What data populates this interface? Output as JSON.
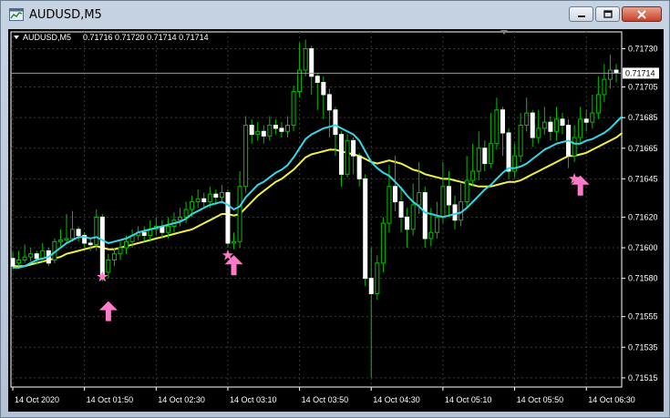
{
  "window": {
    "title": "AUDUSD,M5",
    "icons": [
      "chart-app-icon",
      "minimize-icon",
      "maximize-icon",
      "close-icon"
    ]
  },
  "colors": {
    "background": "#000000",
    "grid": "#3a3a3a",
    "axis_text": "#ffffff",
    "candle_up": "#00c000",
    "candle_body": "#ffffff",
    "ma_fast": "#33d7e8",
    "ma_slow": "#f0f040",
    "signal": "#ff7ac8"
  },
  "chart_data": {
    "type": "candlestick",
    "symbol_label": "AUDUSD,M5",
    "ohlc_label": "0.71716 0.71720 0.71714 0.71714",
    "y_ticks": [
      "0.71730",
      "0.71705",
      "0.71685",
      "0.71665",
      "0.71645",
      "0.71620",
      "0.71600",
      "0.71580",
      "0.71555",
      "0.71535",
      "0.71515"
    ],
    "x_ticks": [
      "14 Oct 2020",
      "14 Oct 01:50",
      "14 Oct 02:30",
      "14 Oct 03:10",
      "14 Oct 03:50",
      "14 Oct 04:30",
      "14 Oct 05:10",
      "14 Oct 05:50",
      "14 Oct 06:30"
    ],
    "current_price": "0.71714",
    "ylim": [
      0.71509,
      0.71741
    ],
    "candles": [
      [
        0.71593,
        0.71588,
        0.71597,
        0.71586
      ],
      [
        0.7159,
        0.71592,
        0.71598,
        0.71588
      ],
      [
        0.71592,
        0.71594,
        0.71602,
        0.7159
      ],
      [
        0.71594,
        0.71596,
        0.716,
        0.71591
      ],
      [
        0.71596,
        0.71593,
        0.71598,
        0.71589
      ],
      [
        0.71593,
        0.71598,
        0.71603,
        0.71591
      ],
      [
        0.71598,
        0.7159,
        0.716,
        0.71588
      ],
      [
        0.71592,
        0.71604,
        0.71606,
        0.7159
      ],
      [
        0.71604,
        0.71605,
        0.71612,
        0.716
      ],
      [
        0.71605,
        0.71606,
        0.71622,
        0.71603
      ],
      [
        0.71606,
        0.71612,
        0.71624,
        0.71604
      ],
      [
        0.71612,
        0.71608,
        0.71614,
        0.71604
      ],
      [
        0.71608,
        0.71603,
        0.7161,
        0.716
      ],
      [
        0.71603,
        0.71602,
        0.71606,
        0.71598
      ],
      [
        0.71602,
        0.7162,
        0.71625,
        0.71598
      ],
      [
        0.7162,
        0.71582,
        0.71622,
        0.71578
      ],
      [
        0.71584,
        0.71592,
        0.71596,
        0.7158
      ],
      [
        0.71592,
        0.71596,
        0.716,
        0.71588
      ],
      [
        0.71596,
        0.716,
        0.71604,
        0.71592
      ],
      [
        0.716,
        0.71604,
        0.71608,
        0.71596
      ],
      [
        0.71604,
        0.71608,
        0.71612,
        0.716
      ],
      [
        0.71608,
        0.7161,
        0.71614,
        0.71605
      ],
      [
        0.7161,
        0.71608,
        0.71614,
        0.71604
      ],
      [
        0.71608,
        0.71612,
        0.71618,
        0.71604
      ],
      [
        0.71612,
        0.71614,
        0.7162,
        0.71608
      ],
      [
        0.71614,
        0.7161,
        0.71618,
        0.71606
      ],
      [
        0.7161,
        0.71614,
        0.7162,
        0.71606
      ],
      [
        0.71614,
        0.71618,
        0.71623,
        0.7161
      ],
      [
        0.71618,
        0.7162,
        0.71626,
        0.71614
      ],
      [
        0.7162,
        0.71625,
        0.7163,
        0.71616
      ],
      [
        0.71625,
        0.7163,
        0.71634,
        0.7162
      ],
      [
        0.7163,
        0.71632,
        0.71638,
        0.71626
      ],
      [
        0.71632,
        0.7163,
        0.71636,
        0.71626
      ],
      [
        0.7163,
        0.71635,
        0.7164,
        0.71626
      ],
      [
        0.71635,
        0.71633,
        0.71638,
        0.71628
      ],
      [
        0.71633,
        0.71636,
        0.71641,
        0.71629
      ],
      [
        0.71636,
        0.71603,
        0.71638,
        0.716
      ],
      [
        0.71603,
        0.71604,
        0.7161,
        0.71599
      ],
      [
        0.71604,
        0.7164,
        0.7165,
        0.716
      ],
      [
        0.7164,
        0.7168,
        0.71686,
        0.71636
      ],
      [
        0.7168,
        0.71674,
        0.71684,
        0.71668
      ],
      [
        0.71674,
        0.71676,
        0.71682,
        0.7167
      ],
      [
        0.71676,
        0.71673,
        0.7168,
        0.71668
      ],
      [
        0.71673,
        0.7168,
        0.71686,
        0.7167
      ],
      [
        0.7168,
        0.71678,
        0.71684,
        0.71674
      ],
      [
        0.71678,
        0.71676,
        0.71682,
        0.71672
      ],
      [
        0.71676,
        0.7168,
        0.71686,
        0.71672
      ],
      [
        0.7168,
        0.71702,
        0.71706,
        0.71676
      ],
      [
        0.71702,
        0.71716,
        0.71734,
        0.71698
      ],
      [
        0.71716,
        0.7173,
        0.71736,
        0.71712
      ],
      [
        0.7173,
        0.71712,
        0.71732,
        0.717
      ],
      [
        0.71712,
        0.71708,
        0.71714,
        0.7169
      ],
      [
        0.71708,
        0.717,
        0.71712,
        0.71684
      ],
      [
        0.717,
        0.7169,
        0.71704,
        0.71672
      ],
      [
        0.7169,
        0.71674,
        0.71692,
        0.7166
      ],
      [
        0.71674,
        0.71648,
        0.71676,
        0.7164
      ],
      [
        0.71648,
        0.7167,
        0.71674,
        0.71646
      ],
      [
        0.7167,
        0.7166,
        0.71672,
        0.71648
      ],
      [
        0.7166,
        0.71645,
        0.71662,
        0.7164
      ],
      [
        0.71645,
        0.7158,
        0.71648,
        0.71575
      ],
      [
        0.7158,
        0.7157,
        0.716,
        0.71515
      ],
      [
        0.7157,
        0.7159,
        0.71595,
        0.71566
      ],
      [
        0.7159,
        0.71616,
        0.7162,
        0.71584
      ],
      [
        0.71616,
        0.7164,
        0.71654,
        0.7161
      ],
      [
        0.7164,
        0.7163,
        0.7166,
        0.71624
      ],
      [
        0.7163,
        0.7162,
        0.7164,
        0.7161
      ],
      [
        0.7162,
        0.71612,
        0.71626,
        0.716
      ],
      [
        0.71612,
        0.71628,
        0.71642,
        0.71608
      ],
      [
        0.71628,
        0.71636,
        0.71656,
        0.71622
      ],
      [
        0.71636,
        0.71606,
        0.7164,
        0.716
      ],
      [
        0.71606,
        0.7161,
        0.71626,
        0.71601
      ],
      [
        0.7161,
        0.7162,
        0.7163,
        0.71606
      ],
      [
        0.7162,
        0.7164,
        0.71656,
        0.71616
      ],
      [
        0.7164,
        0.71628,
        0.7165,
        0.7162
      ],
      [
        0.71628,
        0.71618,
        0.71634,
        0.71612
      ],
      [
        0.71618,
        0.7163,
        0.71642,
        0.71614
      ],
      [
        0.7163,
        0.71644,
        0.7166,
        0.71626
      ],
      [
        0.71644,
        0.7165,
        0.71668,
        0.7164
      ],
      [
        0.7165,
        0.71665,
        0.71676,
        0.71644
      ],
      [
        0.71665,
        0.71655,
        0.7167,
        0.7165
      ],
      [
        0.71655,
        0.71668,
        0.71688,
        0.71652
      ],
      [
        0.71668,
        0.7169,
        0.71698,
        0.71664
      ],
      [
        0.7169,
        0.71675,
        0.71692,
        0.7166
      ],
      [
        0.71675,
        0.7165,
        0.71678,
        0.71645
      ],
      [
        0.7165,
        0.7166,
        0.71668,
        0.71646
      ],
      [
        0.7166,
        0.7168,
        0.71688,
        0.71656
      ],
      [
        0.7168,
        0.71688,
        0.71698,
        0.71676
      ],
      [
        0.71688,
        0.71672,
        0.7169,
        0.71666
      ],
      [
        0.71672,
        0.71678,
        0.7169,
        0.71668
      ],
      [
        0.71678,
        0.71682,
        0.71692,
        0.71674
      ],
      [
        0.71682,
        0.71676,
        0.71686,
        0.7167
      ],
      [
        0.71676,
        0.71684,
        0.71692,
        0.7167
      ],
      [
        0.71684,
        0.7168,
        0.71688,
        0.71674
      ],
      [
        0.7168,
        0.7166,
        0.71684,
        0.71652
      ],
      [
        0.7166,
        0.71672,
        0.7168,
        0.71656
      ],
      [
        0.71672,
        0.71684,
        0.71692,
        0.71668
      ],
      [
        0.71684,
        0.71682,
        0.7169,
        0.71676
      ],
      [
        0.71682,
        0.71688,
        0.717,
        0.71678
      ],
      [
        0.71688,
        0.717,
        0.71712,
        0.71684
      ],
      [
        0.717,
        0.7171,
        0.7172,
        0.71695
      ],
      [
        0.7171,
        0.71716,
        0.71726,
        0.71704
      ],
      [
        0.71716,
        0.71714,
        0.7172,
        0.71708
      ]
    ],
    "ma_fast": [
      0.71587,
      0.71587,
      0.71588,
      0.7159,
      0.71592,
      0.71593,
      0.71594,
      0.71597,
      0.716,
      0.71603,
      0.71605,
      0.71607,
      0.71607,
      0.71606,
      0.71607,
      0.71605,
      0.71603,
      0.71604,
      0.71605,
      0.71606,
      0.71608,
      0.7161,
      0.71611,
      0.71612,
      0.71613,
      0.71614,
      0.71615,
      0.71616,
      0.71617,
      0.71619,
      0.71622,
      0.71624,
      0.71626,
      0.71628,
      0.71629,
      0.7163,
      0.71628,
      0.71625,
      0.71627,
      0.71633,
      0.71637,
      0.71641,
      0.71643,
      0.71646,
      0.71649,
      0.71651,
      0.71654,
      0.71659,
      0.71665,
      0.71671,
      0.71674,
      0.71676,
      0.71678,
      0.71679,
      0.7168,
      0.71678,
      0.71676,
      0.71674,
      0.7167,
      0.71663,
      0.71656,
      0.71652,
      0.71649,
      0.71647,
      0.71643,
      0.71639,
      0.71634,
      0.7163,
      0.71627,
      0.71623,
      0.71622,
      0.71621,
      0.7162,
      0.71621,
      0.71622,
      0.71623,
      0.71626,
      0.7163,
      0.71634,
      0.71638,
      0.71641,
      0.71645,
      0.71649,
      0.71652,
      0.71652,
      0.71653,
      0.71655,
      0.71658,
      0.71661,
      0.71664,
      0.71666,
      0.71668,
      0.71669,
      0.7167,
      0.71668,
      0.71668,
      0.7167,
      0.71671,
      0.71673,
      0.71675,
      0.71678,
      0.71682,
      0.71686
    ],
    "ma_slow": [
      0.71588,
      0.71588,
      0.71588,
      0.71589,
      0.7159,
      0.71591,
      0.71592,
      0.71593,
      0.71594,
      0.71596,
      0.71597,
      0.71598,
      0.71599,
      0.716,
      0.71601,
      0.716,
      0.71599,
      0.71599,
      0.716,
      0.71601,
      0.71602,
      0.71603,
      0.71604,
      0.71605,
      0.71606,
      0.71607,
      0.71608,
      0.71609,
      0.7161,
      0.71611,
      0.71612,
      0.71614,
      0.71616,
      0.71618,
      0.7162,
      0.71622,
      0.71622,
      0.71621,
      0.71622,
      0.71626,
      0.7163,
      0.71634,
      0.71637,
      0.7164,
      0.71643,
      0.71645,
      0.71648,
      0.71651,
      0.71655,
      0.71659,
      0.71661,
      0.71662,
      0.71663,
      0.71664,
      0.71664,
      0.71663,
      0.71662,
      0.71661,
      0.7166,
      0.71658,
      0.71656,
      0.71655,
      0.71656,
      0.71657,
      0.71656,
      0.71655,
      0.71653,
      0.71651,
      0.7165,
      0.71648,
      0.71647,
      0.71646,
      0.71645,
      0.71645,
      0.71644,
      0.71643,
      0.71642,
      0.71641,
      0.7164,
      0.7164,
      0.7164,
      0.71641,
      0.71642,
      0.71643,
      0.71643,
      0.71644,
      0.71646,
      0.71648,
      0.7165,
      0.71652,
      0.71654,
      0.71656,
      0.71658,
      0.7166,
      0.7166,
      0.71661,
      0.71662,
      0.71664,
      0.71666,
      0.71668,
      0.7167,
      0.71672,
      0.71675
    ],
    "signals": [
      {
        "type": "star",
        "price": 0.71581,
        "candle": 15
      },
      {
        "type": "arrow-up",
        "price": 0.71558,
        "candle": 16
      },
      {
        "type": "star",
        "price": 0.71595,
        "candle": 36
      },
      {
        "type": "arrow-up",
        "price": 0.71588,
        "candle": 37
      },
      {
        "type": "star",
        "price": 0.71645,
        "candle": 94
      },
      {
        "type": "arrow-up",
        "price": 0.7164,
        "candle": 95
      }
    ]
  }
}
